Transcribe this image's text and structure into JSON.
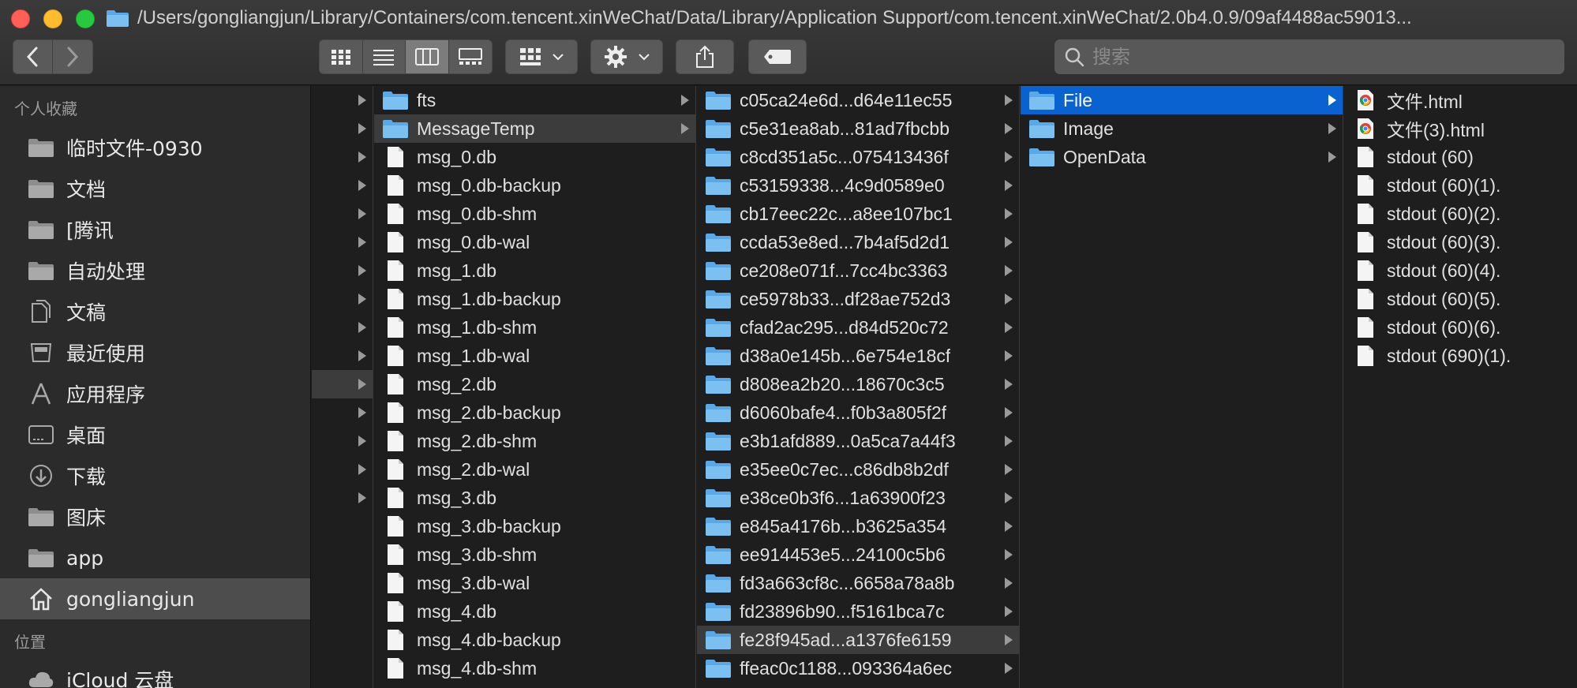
{
  "window": {
    "title": "/Users/gongliangjun/Library/Containers/com.tencent.xinWeChat/Data/Library/Application Support/com.tencent.xinWeChat/2.0b4.0.9/09af4488ac59013..."
  },
  "toolbar": {
    "view_modes": [
      "icon-view",
      "list-view",
      "column-view",
      "gallery-view"
    ],
    "active_view": "column-view",
    "search_placeholder": "搜索"
  },
  "sidebar": {
    "favorites_header": "个人收藏",
    "favorites": [
      {
        "label": "临时文件-0930",
        "icon": "folder-icon"
      },
      {
        "label": "文档",
        "icon": "folder-icon"
      },
      {
        "label": "[腾讯",
        "icon": "folder-icon"
      },
      {
        "label": "自动处理",
        "icon": "folder-icon"
      },
      {
        "label": "文稿",
        "icon": "documents-icon"
      },
      {
        "label": "最近使用",
        "icon": "recents-icon"
      },
      {
        "label": "应用程序",
        "icon": "applications-icon"
      },
      {
        "label": "桌面",
        "icon": "desktop-icon"
      },
      {
        "label": "下载",
        "icon": "downloads-icon"
      },
      {
        "label": "图床",
        "icon": "folder-icon"
      },
      {
        "label": "app",
        "icon": "folder-icon"
      },
      {
        "label": "gongliangjun",
        "icon": "home-icon",
        "selected": true
      }
    ],
    "locations_header": "位置",
    "locations": [
      {
        "label": "iCloud 云盘",
        "icon": "cloud-icon"
      }
    ]
  },
  "column0": {
    "rows": 15,
    "highlight_row": 10
  },
  "column1": {
    "items": [
      {
        "name": "fts",
        "type": "folder",
        "arrow": true
      },
      {
        "name": "MessageTemp",
        "type": "folder",
        "arrow": true,
        "highlight": true
      },
      {
        "name": "msg_0.db",
        "type": "file"
      },
      {
        "name": "msg_0.db-backup",
        "type": "file"
      },
      {
        "name": "msg_0.db-shm",
        "type": "file"
      },
      {
        "name": "msg_0.db-wal",
        "type": "file"
      },
      {
        "name": "msg_1.db",
        "type": "file"
      },
      {
        "name": "msg_1.db-backup",
        "type": "file"
      },
      {
        "name": "msg_1.db-shm",
        "type": "file"
      },
      {
        "name": "msg_1.db-wal",
        "type": "file"
      },
      {
        "name": "msg_2.db",
        "type": "file"
      },
      {
        "name": "msg_2.db-backup",
        "type": "file"
      },
      {
        "name": "msg_2.db-shm",
        "type": "file"
      },
      {
        "name": "msg_2.db-wal",
        "type": "file"
      },
      {
        "name": "msg_3.db",
        "type": "file"
      },
      {
        "name": "msg_3.db-backup",
        "type": "file"
      },
      {
        "name": "msg_3.db-shm",
        "type": "file"
      },
      {
        "name": "msg_3.db-wal",
        "type": "file"
      },
      {
        "name": "msg_4.db",
        "type": "file"
      },
      {
        "name": "msg_4.db-backup",
        "type": "file"
      },
      {
        "name": "msg_4.db-shm",
        "type": "file"
      }
    ]
  },
  "column2": {
    "items": [
      {
        "name": "c05ca24e6d...d64e11ec55"
      },
      {
        "name": "c5e31ea8ab...81ad7fbcbb"
      },
      {
        "name": "c8cd351a5c...075413436f"
      },
      {
        "name": "c53159338...4c9d0589e0"
      },
      {
        "name": "cb17eec22c...a8ee107bc1"
      },
      {
        "name": "ccda53e8ed...7b4af5d2d1"
      },
      {
        "name": "ce208e071f...7cc4bc3363"
      },
      {
        "name": "ce5978b33...df28ae752d3"
      },
      {
        "name": "cfad2ac295...d84d520c72"
      },
      {
        "name": "d38a0e145b...6e754e18cf"
      },
      {
        "name": "d808ea2b20...18670c3c5"
      },
      {
        "name": "d6060bafe4...f0b3a805f2f"
      },
      {
        "name": "e3b1afd889...0a5ca7a44f3"
      },
      {
        "name": "e35ee0c7ec...c86db8b2df"
      },
      {
        "name": "e38ce0b3f6...1a63900f23"
      },
      {
        "name": "e845a4176b...b3625a354"
      },
      {
        "name": "ee914453e5...24100c5b6"
      },
      {
        "name": "fd3a663cf8c...6658a78a8b"
      },
      {
        "name": "fd23896b90...f5161bca7c"
      },
      {
        "name": "fe28f945ad...a1376fe6159",
        "highlight": true
      },
      {
        "name": "ffeac0c1188...093364a6ec"
      }
    ]
  },
  "column3": {
    "items": [
      {
        "name": "File",
        "selected": true
      },
      {
        "name": "Image"
      },
      {
        "name": "OpenData"
      }
    ]
  },
  "column4": {
    "items": [
      {
        "name": "文件.html",
        "type": "html"
      },
      {
        "name": "文件(3).html",
        "type": "html"
      },
      {
        "name": "stdout (60)",
        "type": "file"
      },
      {
        "name": "stdout (60)(1).",
        "type": "file"
      },
      {
        "name": "stdout (60)(2).",
        "type": "file"
      },
      {
        "name": "stdout (60)(3).",
        "type": "file"
      },
      {
        "name": "stdout (60)(4).",
        "type": "file"
      },
      {
        "name": "stdout (60)(5).",
        "type": "file"
      },
      {
        "name": "stdout (60)(6).",
        "type": "file"
      },
      {
        "name": "stdout (690)(1).",
        "type": "file"
      }
    ]
  },
  "colors": {
    "selection": "#0a62d0",
    "folder": "#5aa9e6",
    "window_bg": "#1e1e1e",
    "sidebar_bg": "#2b2b2b"
  }
}
